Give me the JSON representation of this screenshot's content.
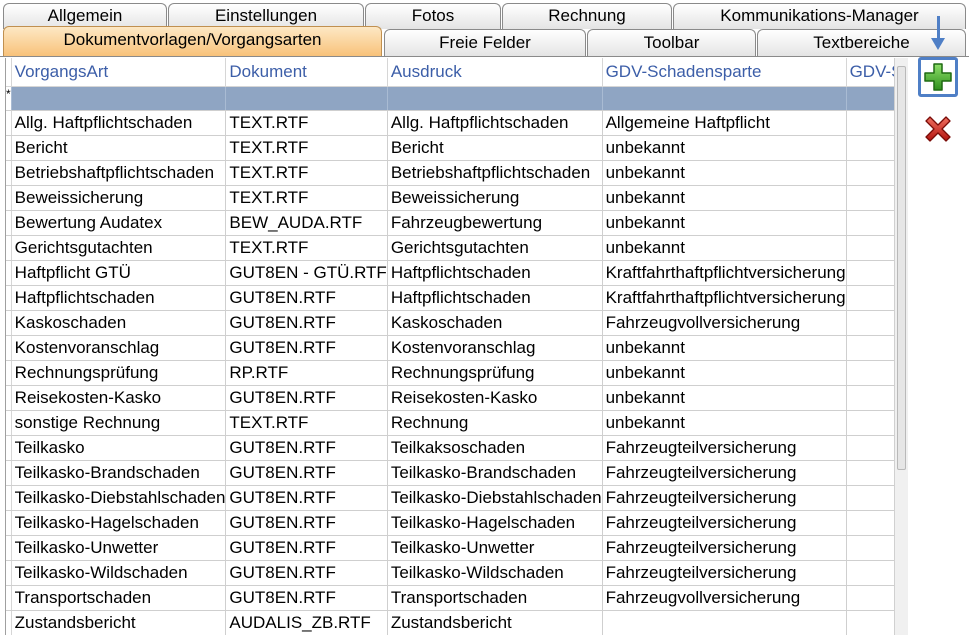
{
  "tabs": {
    "row1": [
      "Allgemein",
      "Einstellungen",
      "Fotos",
      "Rechnung",
      "Kommunikations-Manager"
    ],
    "row2": [
      "Dokumentvorlagen/Vorgangsarten",
      "Freie Felder",
      "Toolbar",
      "Textbereiche"
    ],
    "active": "Dokumentvorlagen/Vorgangsarten"
  },
  "grid": {
    "new_row_marker": "*",
    "columns": [
      "VorgangsArt",
      "Dokument",
      "Ausdruck",
      "GDV-Schadensparte",
      "GDV-Schadenart"
    ],
    "rows": [
      [
        "Allg. Haftpflichtschaden",
        "TEXT.RTF",
        "Allg. Haftpflichtschaden",
        "Allgemeine Haftpflicht",
        ""
      ],
      [
        "Bericht",
        "TEXT.RTF",
        "Bericht",
        "unbekannt",
        ""
      ],
      [
        "Betriebshaftpflichtschaden",
        "TEXT.RTF",
        "Betriebshaftpflichtschaden",
        "unbekannt",
        ""
      ],
      [
        "Beweissicherung",
        "TEXT.RTF",
        "Beweissicherung",
        "unbekannt",
        ""
      ],
      [
        "Bewertung Audatex",
        "BEW_AUDA.RTF",
        "Fahrzeugbewertung",
        "unbekannt",
        ""
      ],
      [
        "Gerichtsgutachten",
        "TEXT.RTF",
        "Gerichtsgutachten",
        "unbekannt",
        ""
      ],
      [
        "Haftpflicht GTÜ",
        "GUT8EN - GTÜ.RTF",
        "Haftpflichtschaden",
        "Kraftfahrthaftpflichtversicherung",
        ""
      ],
      [
        "Haftpflichtschaden",
        "GUT8EN.RTF",
        "Haftpflichtschaden",
        "Kraftfahrthaftpflichtversicherung",
        ""
      ],
      [
        "Kaskoschaden",
        "GUT8EN.RTF",
        "Kaskoschaden",
        "Fahrzeugvollversicherung",
        ""
      ],
      [
        "Kostenvoranschlag",
        "GUT8EN.RTF",
        "Kostenvoranschlag",
        "unbekannt",
        ""
      ],
      [
        "Rechnungsprüfung",
        "RP.RTF",
        "Rechnungsprüfung",
        "unbekannt",
        ""
      ],
      [
        "Reisekosten-Kasko",
        "GUT8EN.RTF",
        "Reisekosten-Kasko",
        "unbekannt",
        ""
      ],
      [
        "sonstige Rechnung",
        "TEXT.RTF",
        "Rechnung",
        "unbekannt",
        ""
      ],
      [
        "Teilkasko",
        "GUT8EN.RTF",
        "Teilkaksoschaden",
        "Fahrzeugteilversicherung",
        ""
      ],
      [
        "Teilkasko-Brandschaden",
        "GUT8EN.RTF",
        "Teilkasko-Brandschaden",
        "Fahrzeugteilversicherung",
        ""
      ],
      [
        "Teilkasko-Diebstahlschaden",
        "GUT8EN.RTF",
        "Teilkasko-Diebstahlschaden",
        "Fahrzeugteilversicherung",
        ""
      ],
      [
        "Teilkasko-Hagelschaden",
        "GUT8EN.RTF",
        "Teilkasko-Hagelschaden",
        "Fahrzeugteilversicherung",
        ""
      ],
      [
        "Teilkasko-Unwetter",
        "GUT8EN.RTF",
        "Teilkasko-Unwetter",
        "Fahrzeugteilversicherung",
        ""
      ],
      [
        "Teilkasko-Wildschaden",
        "GUT8EN.RTF",
        "Teilkasko-Wildschaden",
        "Fahrzeugteilversicherung",
        ""
      ],
      [
        "Transportschaden",
        "GUT8EN.RTF",
        "Transportschaden",
        "Fahrzeugvollversicherung",
        ""
      ],
      [
        "Zustandsbericht",
        "AUDALIS_ZB.RTF",
        "Zustandsbericht",
        "",
        ""
      ]
    ]
  },
  "side_buttons": {
    "add_icon": "plus-icon",
    "delete_icon": "delete-x-icon",
    "add_color": "#3fa42a",
    "delete_color": "#d0201a",
    "highlight_color": "#4f7fc6"
  }
}
